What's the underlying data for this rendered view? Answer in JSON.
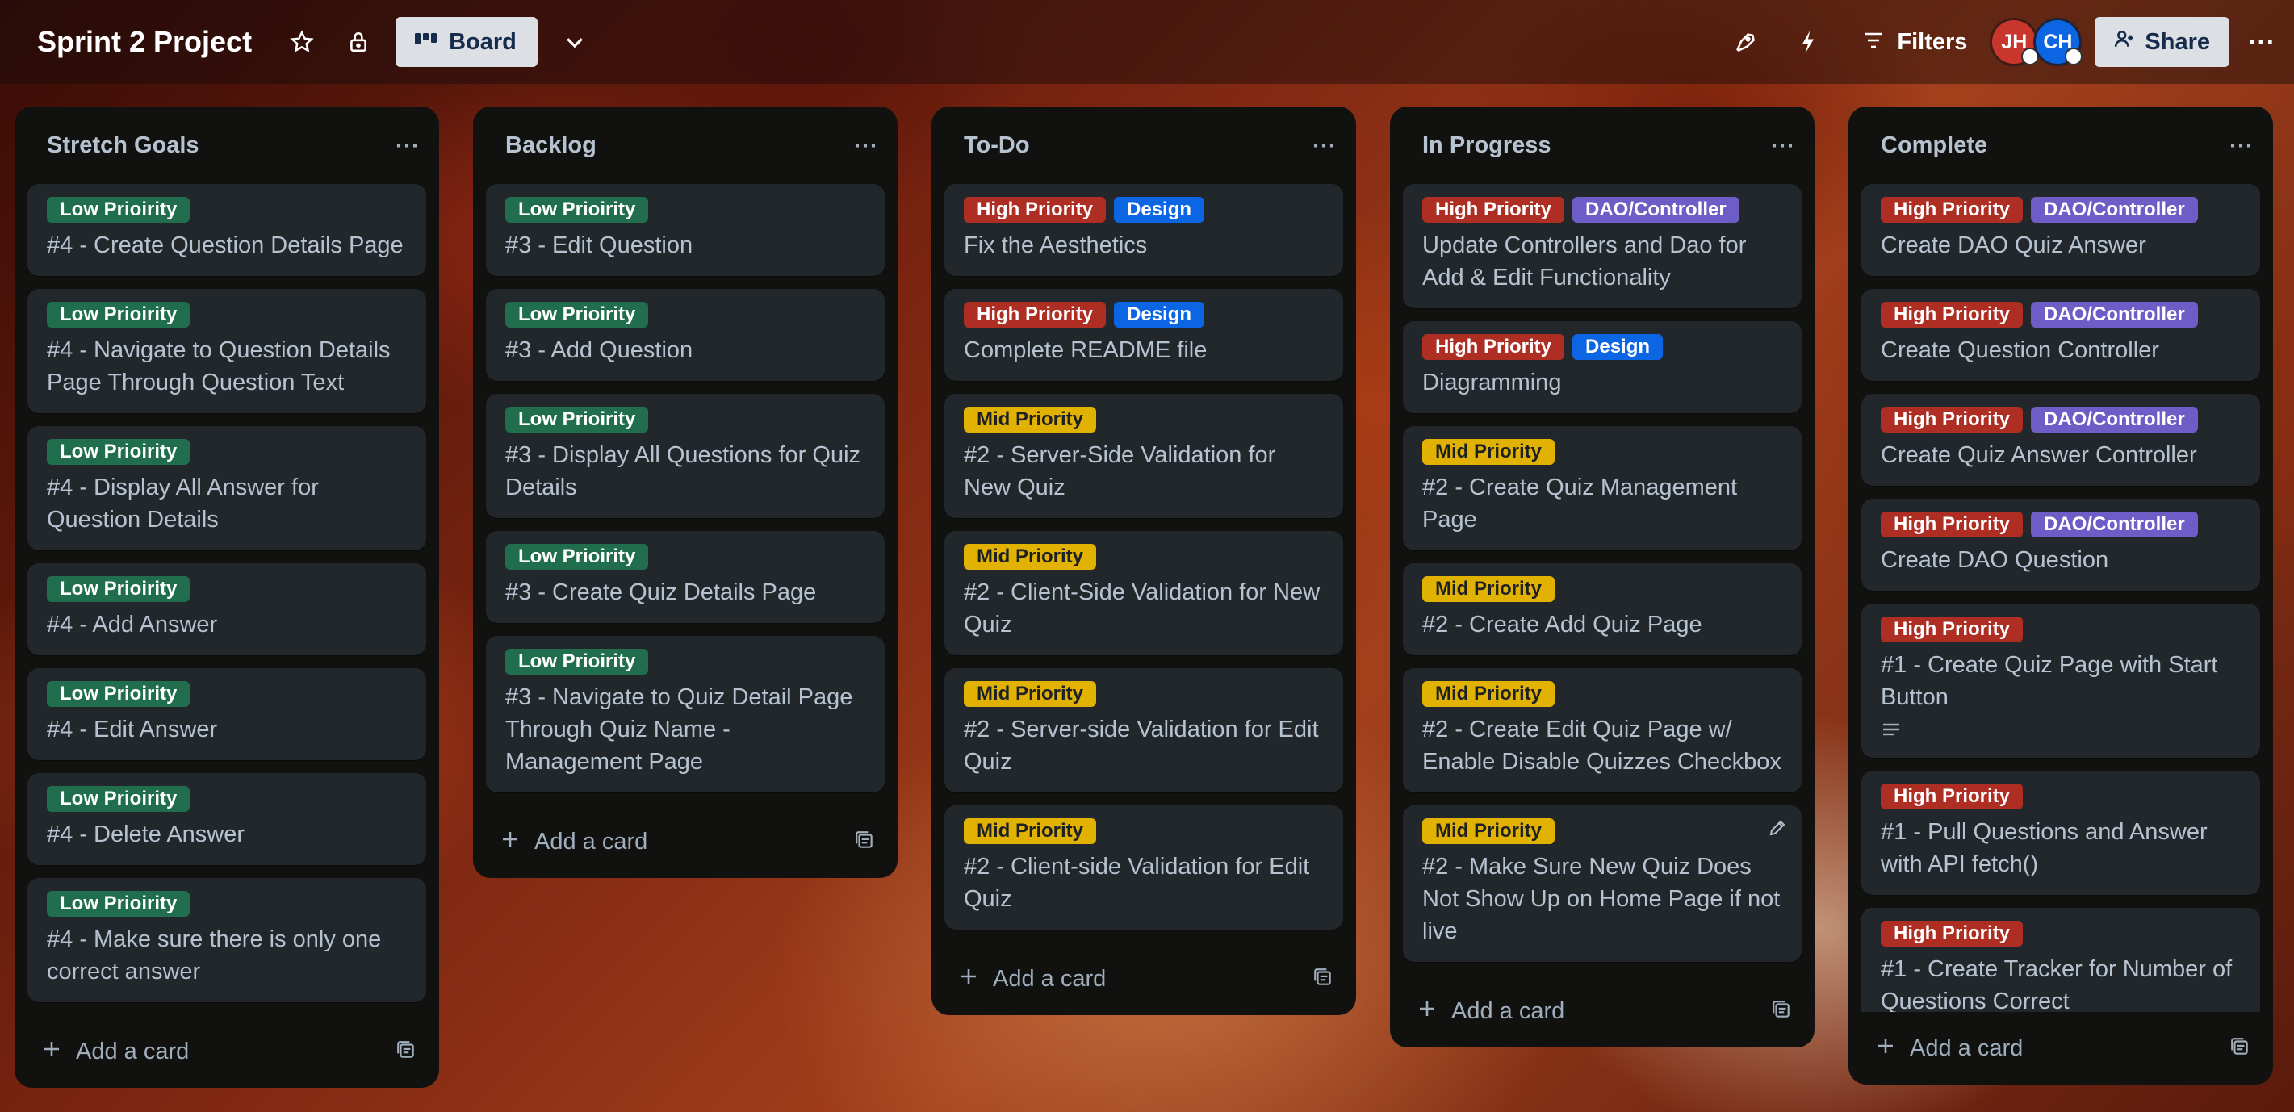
{
  "header": {
    "board_title": "Sprint 2 Project",
    "view_label": "Board",
    "filters_label": "Filters",
    "share_label": "Share",
    "members": [
      {
        "initials": "JH",
        "color": "#c9372c"
      },
      {
        "initials": "CH",
        "color": "#0c66e4"
      }
    ]
  },
  "add_card_label": "Add a card",
  "lists": [
    {
      "title": "Stretch Goals",
      "cards": [
        {
          "labels": [
            {
              "text": "Low Prioirity",
              "kind": "low"
            }
          ],
          "title": "#4 - Create Question Details Page"
        },
        {
          "labels": [
            {
              "text": "Low Prioirity",
              "kind": "low"
            }
          ],
          "title": "#4 - Navigate to Question Details Page Through Question Text"
        },
        {
          "labels": [
            {
              "text": "Low Prioirity",
              "kind": "low"
            }
          ],
          "title": "#4 - Display All Answer for Question Details"
        },
        {
          "labels": [
            {
              "text": "Low Prioirity",
              "kind": "low"
            }
          ],
          "title": "#4 - Add Answer"
        },
        {
          "labels": [
            {
              "text": "Low Prioirity",
              "kind": "low"
            }
          ],
          "title": "#4 - Edit Answer"
        },
        {
          "labels": [
            {
              "text": "Low Prioirity",
              "kind": "low"
            }
          ],
          "title": "#4 - Delete Answer"
        },
        {
          "labels": [
            {
              "text": "Low Prioirity",
              "kind": "low"
            }
          ],
          "title": "#4 - Make sure there is only one correct answer"
        }
      ]
    },
    {
      "title": "Backlog",
      "cards": [
        {
          "labels": [
            {
              "text": "Low Prioirity",
              "kind": "low"
            }
          ],
          "title": "#3 - Edit Question"
        },
        {
          "labels": [
            {
              "text": "Low Prioirity",
              "kind": "low"
            }
          ],
          "title": "#3 - Add Question"
        },
        {
          "labels": [
            {
              "text": "Low Prioirity",
              "kind": "low"
            }
          ],
          "title": "#3 - Display All Questions for Quiz Details"
        },
        {
          "labels": [
            {
              "text": "Low Prioirity",
              "kind": "low"
            }
          ],
          "title": "#3 - Create Quiz Details Page"
        },
        {
          "labels": [
            {
              "text": "Low Prioirity",
              "kind": "low"
            }
          ],
          "title": "#3 - Navigate to Quiz Detail Page Through Quiz Name - Management Page"
        }
      ]
    },
    {
      "title": "To-Do",
      "cards": [
        {
          "labels": [
            {
              "text": "High Priority",
              "kind": "high"
            },
            {
              "text": "Design",
              "kind": "design"
            }
          ],
          "title": "Fix the Aesthetics"
        },
        {
          "labels": [
            {
              "text": "High Priority",
              "kind": "high"
            },
            {
              "text": "Design",
              "kind": "design"
            }
          ],
          "title": "Complete README file"
        },
        {
          "labels": [
            {
              "text": "Mid Priority",
              "kind": "mid"
            }
          ],
          "title": "#2 - Server-Side Validation for New Quiz"
        },
        {
          "labels": [
            {
              "text": "Mid Priority",
              "kind": "mid"
            }
          ],
          "title": "#2 - Client-Side Validation for New Quiz"
        },
        {
          "labels": [
            {
              "text": "Mid Priority",
              "kind": "mid"
            }
          ],
          "title": "#2 - Server-side Validation for Edit Quiz"
        },
        {
          "labels": [
            {
              "text": "Mid Priority",
              "kind": "mid"
            }
          ],
          "title": "#2 - Client-side Validation for Edit Quiz"
        }
      ]
    },
    {
      "title": "In Progress",
      "cards": [
        {
          "labels": [
            {
              "text": "High Priority",
              "kind": "high"
            },
            {
              "text": "DAO/Controller",
              "kind": "dao"
            }
          ],
          "title": "Update Controllers and Dao for Add & Edit Functionality"
        },
        {
          "labels": [
            {
              "text": "High Priority",
              "kind": "high"
            },
            {
              "text": "Design",
              "kind": "design"
            }
          ],
          "title": "Diagramming"
        },
        {
          "labels": [
            {
              "text": "Mid Priority",
              "kind": "mid"
            }
          ],
          "title": "#2 - Create Quiz Management Page"
        },
        {
          "labels": [
            {
              "text": "Mid Priority",
              "kind": "mid"
            }
          ],
          "title": "#2 - Create Add Quiz Page"
        },
        {
          "labels": [
            {
              "text": "Mid Priority",
              "kind": "mid"
            }
          ],
          "title": "#2 - Create Edit Quiz Page w/ Enable Disable Quizzes Checkbox"
        },
        {
          "labels": [
            {
              "text": "Mid Priority",
              "kind": "mid"
            }
          ],
          "title": "#2 - Make Sure New Quiz Does Not Show Up on Home Page if not live",
          "edit": true
        }
      ]
    },
    {
      "title": "Complete",
      "cards": [
        {
          "labels": [
            {
              "text": "High Priority",
              "kind": "high"
            },
            {
              "text": "DAO/Controller",
              "kind": "dao"
            }
          ],
          "title": "Create DAO Quiz Answer"
        },
        {
          "labels": [
            {
              "text": "High Priority",
              "kind": "high"
            },
            {
              "text": "DAO/Controller",
              "kind": "dao"
            }
          ],
          "title": "Create Question Controller"
        },
        {
          "labels": [
            {
              "text": "High Priority",
              "kind": "high"
            },
            {
              "text": "DAO/Controller",
              "kind": "dao"
            }
          ],
          "title": "Create Quiz Answer Controller"
        },
        {
          "labels": [
            {
              "text": "High Priority",
              "kind": "high"
            },
            {
              "text": "DAO/Controller",
              "kind": "dao"
            }
          ],
          "title": "Create DAO Question"
        },
        {
          "labels": [
            {
              "text": "High Priority",
              "kind": "high"
            }
          ],
          "title": "#1 - Create Quiz Page with Start Button",
          "has_description": true
        },
        {
          "labels": [
            {
              "text": "High Priority",
              "kind": "high"
            }
          ],
          "title": "#1 - Pull Questions and Answer with API fetch()"
        },
        {
          "labels": [
            {
              "text": "High Priority",
              "kind": "high"
            }
          ],
          "title": "#1 - Create Tracker for Number of Questions Correct"
        }
      ]
    }
  ]
}
